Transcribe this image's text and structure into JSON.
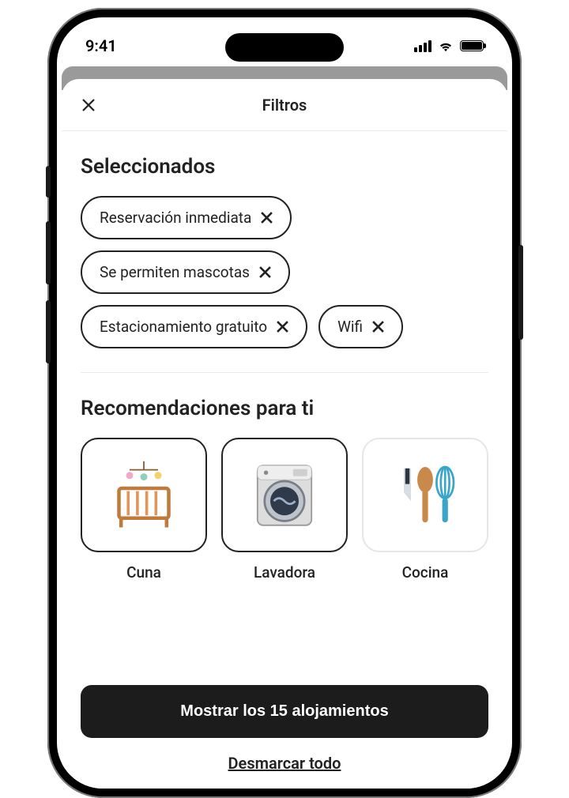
{
  "statusBar": {
    "time": "9:41"
  },
  "sheet": {
    "title": "Filtros",
    "selected": {
      "title": "Seleccionados",
      "chips": [
        {
          "label": "Reservación inmediata"
        },
        {
          "label": "Se permiten mascotas"
        },
        {
          "label": "Estacionamiento gratuito"
        },
        {
          "label": "Wifi"
        }
      ]
    },
    "recommended": {
      "title": "Recomendaciones para ti",
      "cards": [
        {
          "label": "Cuna",
          "icon": "crib",
          "selected": true
        },
        {
          "label": "Lavadora",
          "icon": "washer",
          "selected": true
        },
        {
          "label": "Cocina",
          "icon": "kitchen",
          "selected": false
        }
      ]
    },
    "footer": {
      "showButton": "Mostrar los 15 alojamientos",
      "clearAll": "Desmarcar todo"
    }
  }
}
